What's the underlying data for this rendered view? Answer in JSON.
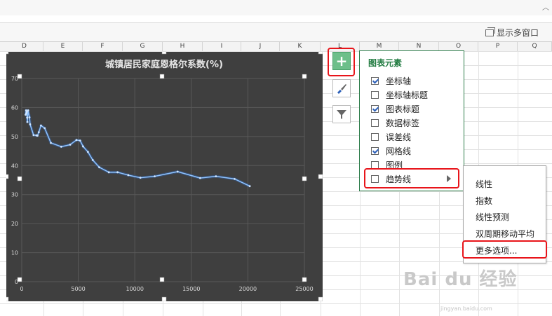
{
  "window": {
    "collapse_glyph": "︿",
    "multi_window_label": "显示多窗口"
  },
  "columns": [
    "D",
    "E",
    "F",
    "G",
    "H",
    "I",
    "J",
    "K",
    "L",
    "M",
    "N",
    "O",
    "P",
    "Q"
  ],
  "side_buttons": {
    "elements_icon": "plus-icon",
    "style_icon": "brush-icon",
    "filter_icon": "funnel-icon"
  },
  "chart_elements_panel": {
    "title": "图表元素",
    "options": [
      {
        "label": "坐标轴",
        "checked": true
      },
      {
        "label": "坐标轴标题",
        "checked": false
      },
      {
        "label": "图表标题",
        "checked": true
      },
      {
        "label": "数据标签",
        "checked": false
      },
      {
        "label": "误差线",
        "checked": false
      },
      {
        "label": "网格线",
        "checked": true
      },
      {
        "label": "图例",
        "checked": false
      },
      {
        "label": "趋势线",
        "checked": false
      }
    ]
  },
  "trendline_submenu": {
    "items": [
      "线性",
      "指数",
      "线性预测",
      "双周期移动平均",
      "更多选项..."
    ]
  },
  "watermark": {
    "text": "Bai du 经验",
    "url": "jingyan.baidu.com"
  },
  "colors": {
    "chart_bg": "#3f3f3f",
    "line": "#5b9bd5",
    "accent_green": "#1f7a3f",
    "highlight_red": "#e8141a"
  },
  "chart_data": {
    "type": "line",
    "title": "城镇居民家庭恩格尔系数(%)",
    "xlabel": "",
    "ylabel": "",
    "xlim": [
      0,
      25000
    ],
    "ylim": [
      0,
      70
    ],
    "x_ticks": [
      0,
      5000,
      10000,
      15000,
      20000,
      25000
    ],
    "y_ticks": [
      0,
      10,
      20,
      30,
      40,
      50,
      60,
      70
    ],
    "grid": true,
    "legend": "none",
    "series": [
      {
        "x": [
          343,
          387,
          410,
          454,
          478,
          500,
          565,
          685,
          739,
          1046,
          1298,
          1389,
          1510,
          1701,
          2027,
          2577,
          3496,
          4283,
          4838,
          5160,
          5425,
          5854,
          6280,
          6860,
          7703,
          8472,
          9422,
          10493,
          11759,
          13786,
          15781,
          17175,
          18823,
          20167
        ],
        "y": [
          57.5,
          59,
          58,
          58.5,
          56.5,
          55,
          59,
          56.6,
          54.2,
          50.5,
          50.4,
          50.3,
          51.5,
          53.8,
          52.9,
          47.8,
          46.5,
          47.2,
          48.8,
          48.6,
          46.6,
          44.7,
          41.9,
          39.4,
          37.7,
          37.7,
          36.7,
          35.8,
          36.3,
          37.9,
          35.7,
          36.3,
          35.4,
          32.9
        ]
      }
    ]
  }
}
